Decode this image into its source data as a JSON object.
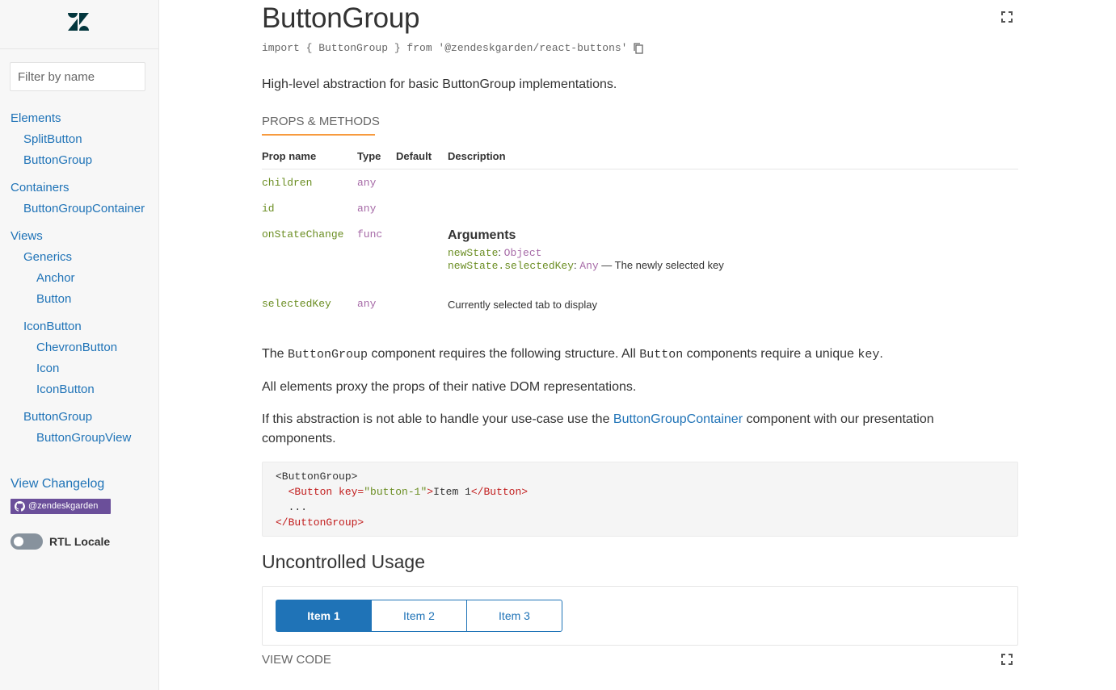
{
  "sidebar": {
    "filter_placeholder": "Filter by name",
    "nav": [
      {
        "label": "Elements",
        "level": 0
      },
      {
        "label": "SplitButton",
        "level": 1
      },
      {
        "label": "ButtonGroup",
        "level": 1
      },
      {
        "label": "Containers",
        "level": 0
      },
      {
        "label": "ButtonGroupContainer",
        "level": 1
      },
      {
        "label": "Views",
        "level": 0
      },
      {
        "label": "Generics",
        "level": 1
      },
      {
        "label": "Anchor",
        "level": 2
      },
      {
        "label": "Button",
        "level": 2
      },
      {
        "label": "IconButton",
        "level": 1
      },
      {
        "label": "ChevronButton",
        "level": 2
      },
      {
        "label": "Icon",
        "level": 2
      },
      {
        "label": "IconButton",
        "level": 2
      },
      {
        "label": "ButtonGroup",
        "level": 1
      },
      {
        "label": "ButtonGroupView",
        "level": 2
      }
    ],
    "changelog": "View Changelog",
    "github_badge": "@zendeskgarden",
    "rtl_label": "RTL Locale"
  },
  "main": {
    "title": "ButtonGroup",
    "import_statement": "import { ButtonGroup } from '@zendeskgarden/react-buttons'",
    "description": "High-level abstraction for basic ButtonGroup implementations.",
    "tab": "PROPS & METHODS",
    "table": {
      "headers": [
        "Prop name",
        "Type",
        "Default",
        "Description"
      ],
      "rows": [
        {
          "name": "children",
          "type": "any"
        },
        {
          "name": "id",
          "type": "any"
        },
        {
          "name": "onStateChange",
          "type": "func"
        },
        {
          "name": "selectedKey",
          "type": "any",
          "description": "Currently selected tab to display"
        }
      ],
      "arguments": {
        "title": "Arguments",
        "arg1_name": "newState",
        "arg1_type": "Object",
        "arg2_name": "newState.selectedKey",
        "arg2_type": "Any",
        "arg2_desc": " — The newly selected key"
      }
    },
    "para1": {
      "t1": "The ",
      "c1": "ButtonGroup",
      "t2": " component requires the following structure. All ",
      "c2": "Button",
      "t3": " components require a unique ",
      "c3": "key",
      "t4": "."
    },
    "para2": "All elements proxy the props of their native DOM representations.",
    "para3": {
      "t1": "If this abstraction is not able to handle your use-case use the ",
      "link": "ButtonGroupContainer",
      "t2": " component with our presentation components."
    },
    "code": {
      "line1": "<ButtonGroup>",
      "line2_open": "<Button key=",
      "line2_str": "\"button-1\"",
      "line2_close": ">",
      "line2_text": "Item 1",
      "line2_end": "</Button>",
      "line3": "...",
      "line4": "</ButtonGroup>"
    },
    "section_title": "Uncontrolled Usage",
    "example_buttons": [
      "Item 1",
      "Item 2",
      "Item 3"
    ],
    "selected_button": 0,
    "view_code": "VIEW CODE"
  },
  "colors": {
    "accent_blue": "#1f73b7",
    "tab_underline": "#f79a3e",
    "prop_name": "#6b8e23",
    "prop_type": "#a66aa7"
  }
}
